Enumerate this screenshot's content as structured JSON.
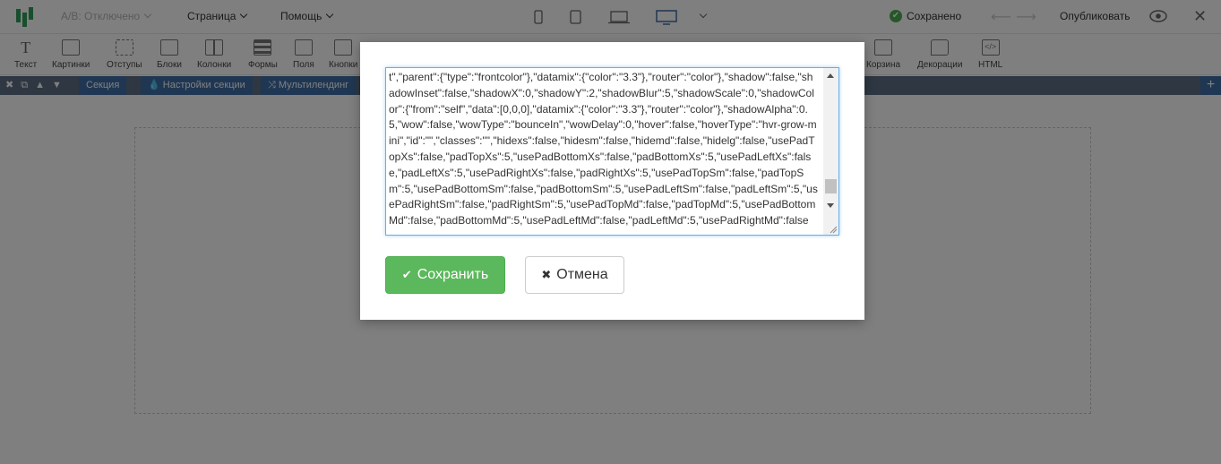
{
  "topbar": {
    "ab_test": "A/B: Отключено",
    "menu_page": "Страница",
    "menu_help": "Помощь",
    "status": "Сохранено",
    "publish": "Опубликовать"
  },
  "toolbar": {
    "items": [
      {
        "label": "Текст",
        "icon": "text-icon"
      },
      {
        "label": "Картинки",
        "icon": "image-icon"
      },
      {
        "label": "Отступы",
        "icon": "spacing-icon"
      },
      {
        "label": "Блоки",
        "icon": "block-icon"
      },
      {
        "label": "Колонки",
        "icon": "columns-icon"
      },
      {
        "label": "Формы",
        "icon": "form-icon"
      },
      {
        "label": "Поля",
        "icon": "field-icon"
      },
      {
        "label": "Кнопки",
        "icon": "button-icon"
      },
      {
        "label": "Корзина",
        "icon": "cart-icon"
      },
      {
        "label": "Декорации",
        "icon": "decoration-icon"
      },
      {
        "label": "HTML",
        "icon": "html-icon"
      }
    ]
  },
  "section_bar": {
    "section_label": "Секция",
    "section_settings": "Настройки секции",
    "multilanding": "Мультилендинг"
  },
  "modal": {
    "code_text": "t\",\"parent\":{\"type\":\"frontcolor\"},\"datamix\":{\"color\":\"3.3\"},\"router\":\"color\"},\"shadow\":false,\"shadowInset\":false,\"shadowX\":0,\"shadowY\":2,\"shadowBlur\":5,\"shadowScale\":0,\"shadowColor\":{\"from\":\"self\",\"data\":[0,0,0],\"datamix\":{\"color\":\"3.3\"},\"router\":\"color\"},\"shadowAlpha\":0.5,\"wow\":false,\"wowType\":\"bounceIn\",\"wowDelay\":0,\"hover\":false,\"hoverType\":\"hvr-grow-mini\",\"id\":\"\",\"classes\":\"\",\"hidexs\":false,\"hidesm\":false,\"hidemd\":false,\"hidelg\":false,\"usePadTopXs\":false,\"padTopXs\":5,\"usePadBottomXs\":false,\"padBottomXs\":5,\"usePadLeftXs\":false,\"padLeftXs\":5,\"usePadRightXs\":false,\"padRightXs\":5,\"usePadTopSm\":false,\"padTopSm\":5,\"usePadBottomSm\":false,\"padBottomSm\":5,\"usePadLeftSm\":false,\"padLeftSm\":5,\"usePadRightSm\":false,\"padRightSm\":5,\"usePadTopMd\":false,\"padTopMd\":5,\"usePadBottomMd\":false,\"padBottomMd\":5,\"usePadLeftMd\":false,\"padLeftMd\":5,\"usePadRightMd\":false",
    "save_label": "Сохранить",
    "cancel_label": "Отмена"
  },
  "colors": {
    "accent_green": "#5cb85c",
    "section_blue": "#3e6ea6",
    "focus_blue": "#66afe9"
  }
}
